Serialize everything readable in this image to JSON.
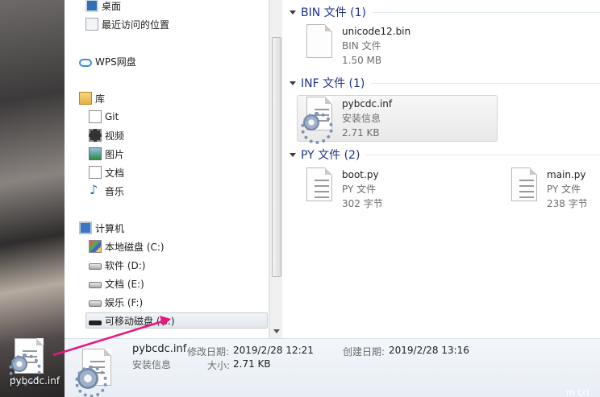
{
  "nav": {
    "items": [
      {
        "label": "桌面",
        "icon": "desktop-icon"
      },
      {
        "label": "最近访问的位置",
        "icon": "recent-places-icon"
      },
      {
        "label": "WPS网盘",
        "icon": "cloud-icon"
      },
      {
        "label": "库",
        "icon": "library-icon"
      },
      {
        "label": "Git",
        "icon": "git-icon"
      },
      {
        "label": "视频",
        "icon": "video-icon"
      },
      {
        "label": "图片",
        "icon": "picture-icon"
      },
      {
        "label": "文档",
        "icon": "document-icon"
      },
      {
        "label": "音乐",
        "icon": "music-icon"
      },
      {
        "label": "计算机",
        "icon": "computer-icon"
      },
      {
        "label": "本地磁盘 (C:)",
        "icon": "system-drive-icon"
      },
      {
        "label": "软件 (D:)",
        "icon": "drive-icon"
      },
      {
        "label": "文档 (E:)",
        "icon": "drive-icon"
      },
      {
        "label": "娱乐 (F:)",
        "icon": "drive-icon"
      },
      {
        "label": "可移动磁盘 (G:)",
        "icon": "usb-drive-icon"
      }
    ],
    "selected_index": 14
  },
  "groups": [
    {
      "title": "BIN 文件 (1)",
      "files": [
        {
          "name": "unicode12.bin",
          "type": "BIN 文件",
          "size": "1.50 MB"
        }
      ]
    },
    {
      "title": "INF 文件 (1)",
      "files": [
        {
          "name": "pybcdc.inf",
          "type": "安装信息",
          "size": "2.71 KB"
        }
      ]
    },
    {
      "title": "PY 文件 (2)",
      "files": [
        {
          "name": "boot.py",
          "type": "PY 文件",
          "size": "302 字节"
        },
        {
          "name": "main.py",
          "type": "PY 文件",
          "size": "238 字节"
        }
      ]
    }
  ],
  "details": {
    "name": "pybcdc.inf",
    "type": "安装信息",
    "modified_label": "修改日期:",
    "modified_value": "2019/2/28 12:21",
    "created_label": "创建日期:",
    "created_value": "2019/2/28 13:16",
    "size_label": "大小:",
    "size_value": "2.71 KB"
  },
  "desktop": {
    "icon_label": "pybcdc.inf"
  },
  "corner_text": "m txt",
  "colors": {
    "group_title": "#1e3287",
    "arrow": "#e6197f",
    "details_bg": "#eef2f7"
  }
}
